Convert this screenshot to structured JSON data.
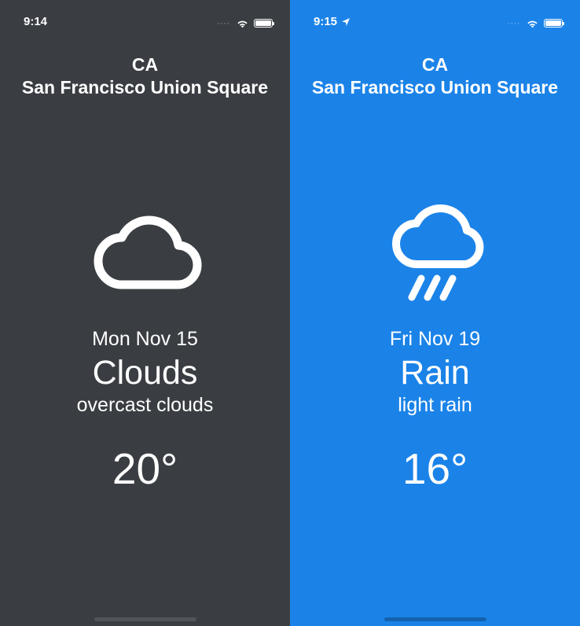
{
  "left": {
    "status": {
      "time": "9:14",
      "show_location_arrow": false
    },
    "header": {
      "state": "CA",
      "city": "San Francisco Union Square"
    },
    "weather": {
      "icon": "cloud-icon",
      "date": "Mon Nov 15",
      "condition": "Clouds",
      "subcondition": "overcast clouds",
      "temperature": "20°"
    }
  },
  "right": {
    "status": {
      "time": "9:15",
      "show_location_arrow": true
    },
    "header": {
      "state": "CA",
      "city": "San Francisco Union Square"
    },
    "weather": {
      "icon": "cloud-rain-icon",
      "date": "Fri Nov 19",
      "condition": "Rain",
      "subcondition": "light rain",
      "temperature": "16°"
    }
  }
}
